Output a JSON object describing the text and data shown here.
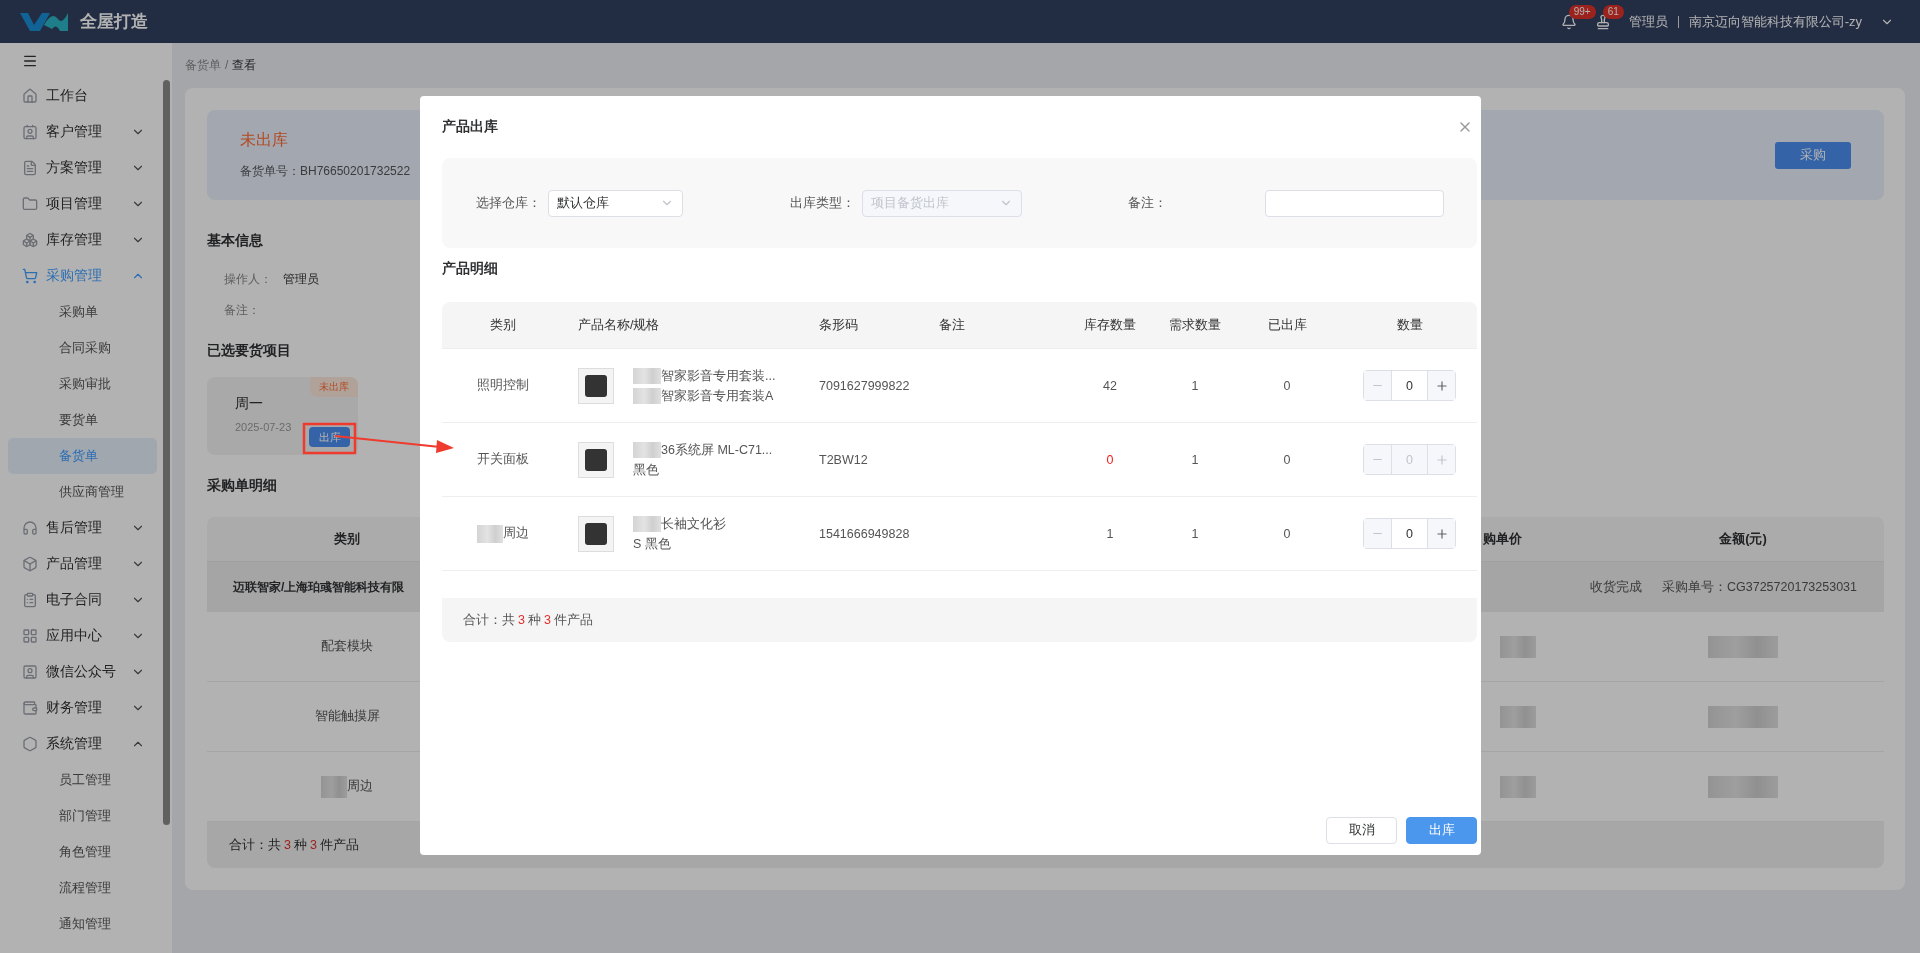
{
  "header": {
    "title": "全屋打造",
    "notifications": [
      {
        "kind": "bell",
        "badge": "99+"
      },
      {
        "kind": "stamp",
        "badge": "61"
      }
    ],
    "user": "管理员",
    "company": "南京迈向智能科技有限公司-zy"
  },
  "sidebar": {
    "items": [
      {
        "label": "工作台",
        "kind": "link",
        "selected": false
      },
      {
        "label": "客户管理",
        "kind": "group",
        "selected": false,
        "expanded": false
      },
      {
        "label": "方案管理",
        "kind": "group",
        "selected": false,
        "expanded": false
      },
      {
        "label": "项目管理",
        "kind": "group",
        "selected": false,
        "expanded": false
      },
      {
        "label": "库存管理",
        "kind": "group",
        "selected": false,
        "expanded": false
      },
      {
        "label": "采购管理",
        "kind": "group",
        "selected": true,
        "expanded": true,
        "children": [
          {
            "label": "采购单",
            "selected": false
          },
          {
            "label": "合同采购",
            "selected": false
          },
          {
            "label": "采购审批",
            "selected": false
          },
          {
            "label": "要货单",
            "selected": false
          },
          {
            "label": "备货单",
            "selected": true
          },
          {
            "label": "供应商管理",
            "selected": false
          }
        ]
      },
      {
        "label": "售后管理",
        "kind": "group",
        "selected": false,
        "expanded": false
      },
      {
        "label": "产品管理",
        "kind": "group",
        "selected": false,
        "expanded": false
      },
      {
        "label": "电子合同",
        "kind": "group",
        "selected": false,
        "expanded": false
      },
      {
        "label": "应用中心",
        "kind": "group",
        "selected": false,
        "expanded": false
      },
      {
        "label": "微信公众号",
        "kind": "group",
        "selected": false,
        "expanded": false
      },
      {
        "label": "财务管理",
        "kind": "group",
        "selected": false,
        "expanded": false
      },
      {
        "label": "系统管理",
        "kind": "group",
        "selected": false,
        "expanded": true,
        "children": [
          {
            "label": "员工管理",
            "selected": false
          },
          {
            "label": "部门管理",
            "selected": false
          },
          {
            "label": "角色管理",
            "selected": false
          },
          {
            "label": "流程管理",
            "selected": false
          },
          {
            "label": "通知管理",
            "selected": false
          }
        ]
      }
    ]
  },
  "breadcrumb": {
    "separator": "/",
    "items": [
      {
        "label": "备货单",
        "selected": false
      },
      {
        "label": "查看",
        "selected": true
      }
    ]
  },
  "status_panel": {
    "status": "未出库",
    "order_label": "备货单号：",
    "order_no": "BH76650201732522",
    "button": "采购"
  },
  "basic_info": {
    "title": "基本信息",
    "fields": [
      {
        "label": "操作人：",
        "value": "管理员"
      },
      {
        "label": "备注："
      }
    ]
  },
  "selected_items": {
    "title": "已选要货项目",
    "cards": [
      {
        "name": "周一",
        "date": "2025-07-23",
        "status": "未出库",
        "action": "出库"
      }
    ]
  },
  "purchase_detail": {
    "title": "采购单明细",
    "columns": [
      "类别",
      "购单价",
      "金额(元)"
    ],
    "group": {
      "supplier": "迈联智家/上海珀彧智能科技有限",
      "status": "收货完成",
      "order_label": "采购单号：",
      "order_no": "CG3725720173253031"
    },
    "rows": [
      {
        "category": "配套模块",
        "category_masked": false,
        "values_masked": true
      },
      {
        "category": "智能触摸屏",
        "category_masked": false,
        "values_masked": true
      },
      {
        "category": "周边",
        "category_masked": true,
        "values_masked": true
      }
    ],
    "footer": {
      "prefix": "合计：共",
      "kinds": "3",
      "mid": "种",
      "count": "3",
      "suffix": "件产品"
    }
  },
  "modal": {
    "title": "产品出库",
    "form": [
      {
        "label": "选择仓库：",
        "kind": "select",
        "value": "默认仓库",
        "disabled": false
      },
      {
        "label": "出库类型：",
        "kind": "select",
        "value": "项目备货出库",
        "disabled": true
      },
      {
        "label": "备注：",
        "kind": "input"
      }
    ],
    "section_title": "产品明细",
    "columns": [
      "类别",
      "产品名称/规格",
      "条形码",
      "备注",
      "库存数量",
      "需求数量",
      "已出库",
      "数量"
    ],
    "rows": [
      {
        "category": "照明控制",
        "category_masked": false,
        "name": "智家影音专用套装...",
        "name_masked": true,
        "spec": "智家影音专用套装A",
        "spec_masked": true,
        "barcode": "7091627999822",
        "stock": "42",
        "stock_short": false,
        "demand": "1",
        "shipped": "0",
        "quantity": "0",
        "disabled": false
      },
      {
        "category": "开关面板",
        "category_masked": false,
        "name": "36系统屏 ML-C71...",
        "name_masked": true,
        "spec": "黑色",
        "spec_masked": false,
        "barcode": "T2BW12",
        "stock": "0",
        "stock_short": true,
        "demand": "1",
        "shipped": "0",
        "quantity": "0",
        "disabled": true
      },
      {
        "category": "周边",
        "category_masked": true,
        "name": "长袖文化衫",
        "name_masked": true,
        "spec": "S 黑色",
        "spec_masked": false,
        "barcode": "1541666949828",
        "stock": "1",
        "stock_short": false,
        "demand": "1",
        "shipped": "0",
        "quantity": "0",
        "disabled": false
      }
    ],
    "footer": {
      "prefix": "合计：共",
      "kinds": "3",
      "mid": "种",
      "count": "3",
      "suffix": "件产品"
    },
    "buttons": [
      {
        "label": "取消",
        "kind": "default"
      },
      {
        "label": "出库",
        "kind": "primary"
      }
    ]
  }
}
